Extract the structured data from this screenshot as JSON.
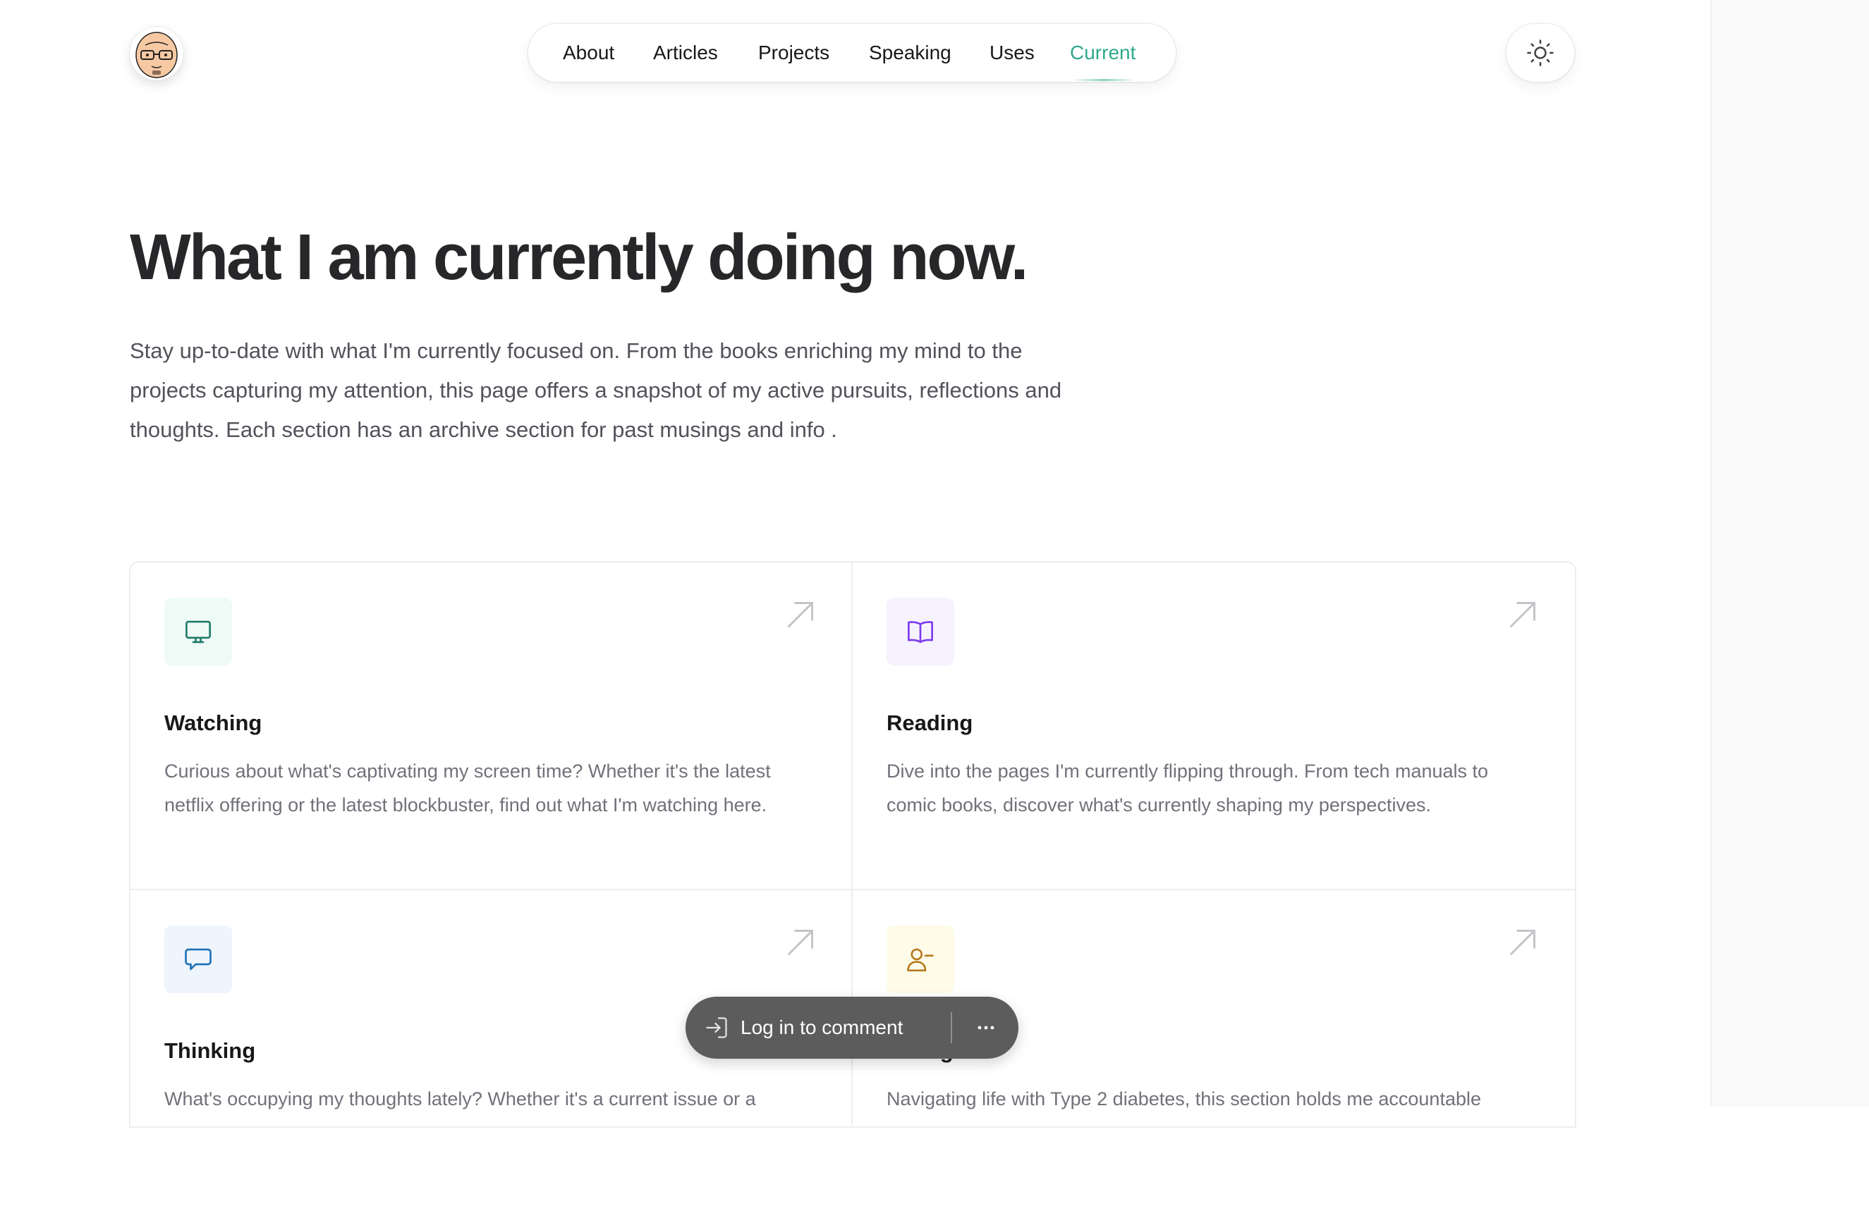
{
  "nav": {
    "items": [
      {
        "label": "About"
      },
      {
        "label": "Articles"
      },
      {
        "label": "Projects"
      },
      {
        "label": "Speaking"
      },
      {
        "label": "Uses"
      },
      {
        "label": "Current"
      }
    ],
    "active": "Current"
  },
  "header": {
    "avatar_icon": "cartoon-face-avatar",
    "theme_toggle_icon": "sun-icon"
  },
  "intro": {
    "title": "What I am currently doing now.",
    "description": "Stay up-to-date with what I'm currently focused on. From the books enriching my mind to the projects capturing my attention, this page offers a snapshot of my active pursuits, reflections and thoughts. Each section has an archive section for past musings and info ."
  },
  "cards": [
    {
      "title": "Watching",
      "icon": "monitor-icon",
      "accent": "#1f7a68",
      "bg": "#eefaf6",
      "description": "Curious about what's captivating my screen time? Whether it's the latest netflix offering or the latest blockbuster, find out what I'm watching here."
    },
    {
      "title": "Reading",
      "icon": "book-open-icon",
      "accent": "#7c3aed",
      "bg": "#f6f2fe",
      "description": "Dive into the pages I'm currently flipping through. From tech manuals to comic books, discover what's currently shaping my perspectives."
    },
    {
      "title": "Thinking",
      "icon": "speech-bubble-icon",
      "accent": "#1e6fb8",
      "bg": "#eef5fc",
      "description": "What's occupying my thoughts lately? Whether it's a current issue or a"
    },
    {
      "title": "Eating",
      "icon": "user-minus-icon",
      "accent": "#b7791f",
      "bg": "#fefbe8",
      "description": "Navigating life with Type 2 diabetes, this section holds me accountable"
    }
  ],
  "comment_bar": {
    "label": "Log in to comment",
    "login_icon": "login-icon",
    "more_icon": "more-horizontal-icon"
  }
}
